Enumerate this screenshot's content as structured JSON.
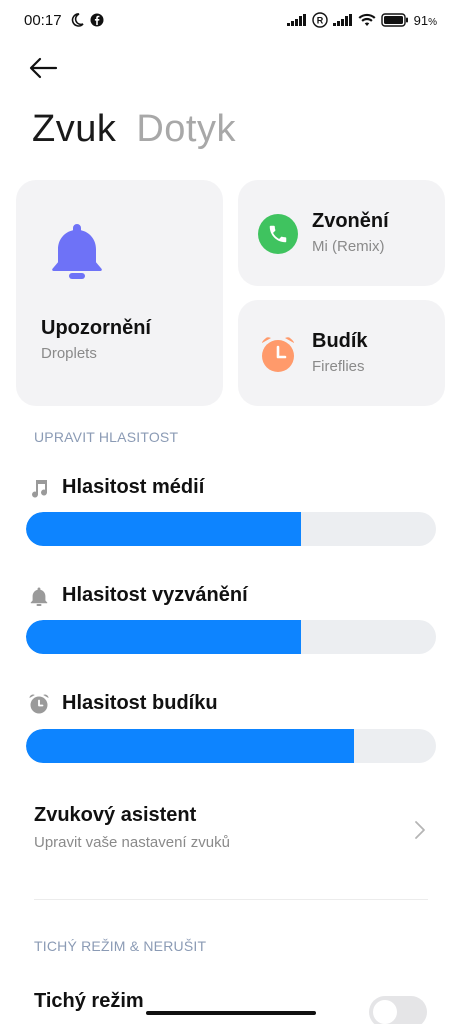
{
  "status_bar": {
    "time": "00:17",
    "battery": "91",
    "battery_unit": "%",
    "icons": [
      "moon-icon",
      "facebook-icon",
      "signal-icon",
      "roaming-icon",
      "signal-icon",
      "wifi-icon",
      "battery-icon"
    ]
  },
  "tabs": [
    {
      "label": "Zvuk",
      "active": true
    },
    {
      "label": "Dotyk",
      "active": false
    }
  ],
  "cards": {
    "notification": {
      "title": "Upozornění",
      "subtitle": "Droplets",
      "icon": "bell-icon",
      "icon_color": "#6e72f7"
    },
    "ringtone": {
      "title": "Zvonění",
      "subtitle": "Mi (Remix)",
      "icon": "phone-icon",
      "icon_color": "#3fc35f"
    },
    "alarm": {
      "title": "Budík",
      "subtitle": "Fireflies",
      "icon": "alarm-clock-icon",
      "icon_color": "#ff9a6b"
    }
  },
  "sections": {
    "volume": "UPRAVIT HLASITOST",
    "silent": "TICHÝ REŽIM & NERUŠIT"
  },
  "volumes": [
    {
      "label": "Hlasitost médií",
      "icon": "music-note-icon",
      "level": 0.67
    },
    {
      "label": "Hlasitost vyzvánění",
      "icon": "bell-icon",
      "level": 0.67
    },
    {
      "label": "Hlasitost budíku",
      "icon": "alarm-clock-icon",
      "level": 0.8
    }
  ],
  "sound_assistant": {
    "title": "Zvukový asistent",
    "subtitle": "Upravit vaše nastavení zvuků"
  },
  "silent_mode": {
    "title": "Tichý režim",
    "enabled": false
  },
  "colors": {
    "accent": "#0d84ff",
    "track": "#eceef1",
    "card_bg": "#f3f3f5"
  }
}
